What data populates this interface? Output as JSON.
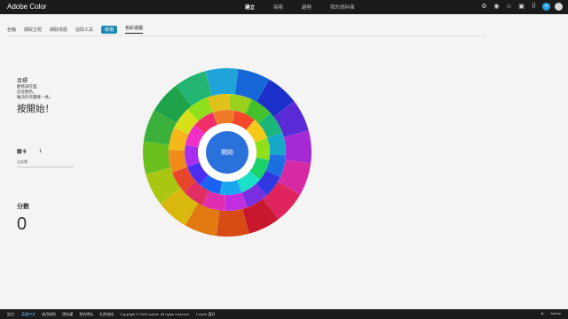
{
  "app": {
    "title": "Adobe Color"
  },
  "topnav": {
    "items": [
      "建立",
      "探索",
      "趨勢",
      "我的資料庫"
    ],
    "active_index": 0
  },
  "topicons": [
    "settings-icon",
    "notifications-icon",
    "profile-icon",
    "chat-icon",
    "apps-icon",
    "creative-cloud-icon",
    "avatar-icon"
  ],
  "tabs": {
    "items": [
      "色輪",
      "擷取主題",
      "擷取漸層",
      "協助工具",
      "新增",
      "色彩遊戲"
    ],
    "pill_index": 4,
    "current_index": 5
  },
  "goal": {
    "title": "目標",
    "lines": [
      "觀看調在面,",
      "記住顏色。",
      "輪流的完畫確一條。"
    ],
    "start_label": "按開始！"
  },
  "level": {
    "label": "關卡",
    "value": "1",
    "sublabel": "全部關"
  },
  "score": {
    "label": "分數",
    "value": "0"
  },
  "wheel": {
    "center_label": "開始",
    "center_color": "#2b71dc"
  },
  "footer": {
    "language_label": "語言:",
    "language_value": "英國中文",
    "links": [
      "使用條款",
      "隱私權",
      "我的隱私",
      "社群指南"
    ],
    "copyright": "Copyright © 2023 Adobe. All rights reserved.",
    "cookie_label": "Cookie 喜好",
    "brand": "Adobe"
  },
  "colors": {
    "accent": "#1473e6",
    "topbar": "#1b1b1b",
    "background": "#f4f4f4"
  }
}
